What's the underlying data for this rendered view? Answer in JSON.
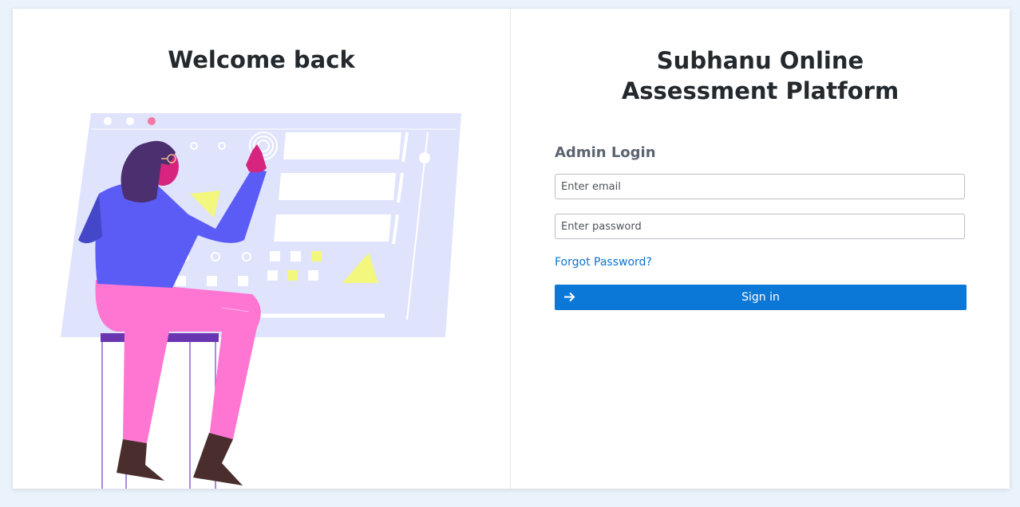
{
  "left": {
    "title": "Welcome back"
  },
  "right": {
    "title": "Subhanu Online Assessment Platform",
    "login_heading": "Admin Login",
    "email": {
      "placeholder": "Enter email",
      "value": ""
    },
    "password": {
      "placeholder": "Enter password",
      "value": ""
    },
    "forgot_label": "Forgot Password?",
    "signin_label": "Sign in",
    "signin_icon": "arrow-right-icon"
  },
  "colors": {
    "page_bg": "#eaf3fb",
    "primary": "#0b78d8",
    "link": "#0b74d4",
    "screen_bg": "#dfe3fc",
    "accent_pink": "#ff76d2",
    "accent_purple": "#5b5cf6",
    "accent_yellow": "#f4f77d"
  }
}
